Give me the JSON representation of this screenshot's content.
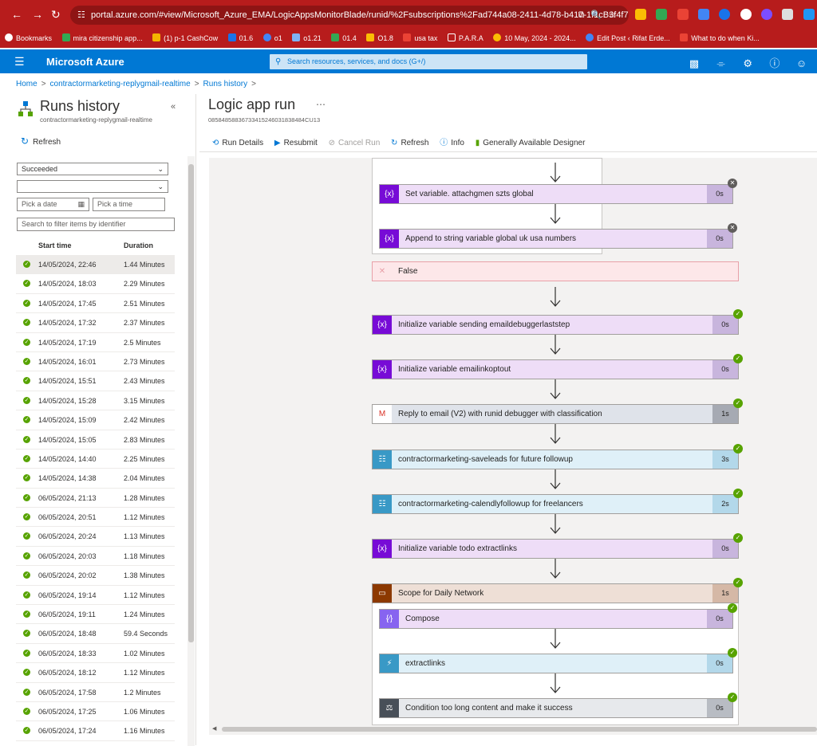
{
  "browser": {
    "url": "portal.azure.com/#view/Microsoft_Azure_EMA/LogicAppsMonitorBlade/runid/%2Fsubscriptions%2Fad744a08-2411-4d78-b417-1f1cB3f4f7...",
    "bookmarks": [
      "Bookmarks",
      "mira citizenship app...",
      "(1) p-1 CashCow",
      "01.6",
      "o1",
      "o1.21",
      "01.4",
      "O1.8",
      "usa tax",
      "P.A.R.A",
      "10 May, 2024 - 2024...",
      "Edit Post ‹ Rifat Erde...",
      "What to do when Ki..."
    ]
  },
  "azure": {
    "brand": "Microsoft Azure",
    "search_placeholder": "Search resources, services, and docs (G+/)"
  },
  "breadcrumb": [
    "Home",
    "contractormarketing-replygmail-realtime",
    "Runs history"
  ],
  "left": {
    "title": "Runs history",
    "subtitle": "contractormarketing-replygmail-realtime",
    "refresh": "Refresh",
    "status_filter": "Succeeded",
    "second_filter": "",
    "date_placeholder": "Pick a date",
    "time_placeholder": "Pick a time",
    "search_placeholder": "Search to filter items by identifier",
    "col_start": "Start time",
    "col_duration": "Duration",
    "runs": [
      {
        "start": "14/05/2024, 22:46",
        "duration": "1.44 Minutes"
      },
      {
        "start": "14/05/2024, 18:03",
        "duration": "2.29 Minutes"
      },
      {
        "start": "14/05/2024, 17:45",
        "duration": "2.51 Minutes"
      },
      {
        "start": "14/05/2024, 17:32",
        "duration": "2.37 Minutes"
      },
      {
        "start": "14/05/2024, 17:19",
        "duration": "2.5 Minutes"
      },
      {
        "start": "14/05/2024, 16:01",
        "duration": "2.73 Minutes"
      },
      {
        "start": "14/05/2024, 15:51",
        "duration": "2.43 Minutes"
      },
      {
        "start": "14/05/2024, 15:28",
        "duration": "3.15 Minutes"
      },
      {
        "start": "14/05/2024, 15:09",
        "duration": "2.42 Minutes"
      },
      {
        "start": "14/05/2024, 15:05",
        "duration": "2.83 Minutes"
      },
      {
        "start": "14/05/2024, 14:40",
        "duration": "2.25 Minutes"
      },
      {
        "start": "14/05/2024, 14:38",
        "duration": "2.04 Minutes"
      },
      {
        "start": "06/05/2024, 21:13",
        "duration": "1.28 Minutes"
      },
      {
        "start": "06/05/2024, 20:51",
        "duration": "1.12 Minutes"
      },
      {
        "start": "06/05/2024, 20:24",
        "duration": "1.13 Minutes"
      },
      {
        "start": "06/05/2024, 20:03",
        "duration": "1.18 Minutes"
      },
      {
        "start": "06/05/2024, 20:02",
        "duration": "1.38 Minutes"
      },
      {
        "start": "06/05/2024, 19:14",
        "duration": "1.12 Minutes"
      },
      {
        "start": "06/05/2024, 19:11",
        "duration": "1.24 Minutes"
      },
      {
        "start": "06/05/2024, 18:48",
        "duration": "59.4 Seconds"
      },
      {
        "start": "06/05/2024, 18:33",
        "duration": "1.02 Minutes"
      },
      {
        "start": "06/05/2024, 18:12",
        "duration": "1.12 Minutes"
      },
      {
        "start": "06/05/2024, 17:58",
        "duration": "1.2 Minutes"
      },
      {
        "start": "06/05/2024, 17:25",
        "duration": "1.06 Minutes"
      },
      {
        "start": "06/05/2024, 17:24",
        "duration": "1.16 Minutes"
      }
    ]
  },
  "main": {
    "title": "Logic app run",
    "run_id": "08584858836733415246031838484CU13",
    "toolbar": {
      "run_details": "Run Details",
      "resubmit": "Resubmit",
      "cancel": "Cancel Run",
      "refresh": "Refresh",
      "info": "Info",
      "designer": "Generally Available Designer"
    },
    "steps": {
      "set_var": {
        "label": "Set variable. attachgmen szts global",
        "duration": "0s",
        "icon": "variable-icon"
      },
      "append": {
        "label": "Append to string variable global uk usa numbers",
        "duration": "0s",
        "icon": "variable-icon"
      },
      "false_branch": {
        "label": "False",
        "icon": "close-icon"
      },
      "init_debugger": {
        "label": "Initialize variable sending emaildebuggerlaststep",
        "duration": "0s",
        "icon": "variable-icon"
      },
      "init_optout": {
        "label": "Initialize variable emailinkoptout",
        "duration": "0s",
        "icon": "variable-icon"
      },
      "reply_email": {
        "label": "Reply to email (V2) with runid debugger with classification",
        "duration": "1s",
        "icon": "gmail-icon"
      },
      "saveleads": {
        "label": "contractormarketing-saveleads for future followup",
        "duration": "3s",
        "icon": "workflow-icon"
      },
      "calendly": {
        "label": "contractormarketing-calendlyfollowup for freelancers",
        "duration": "2s",
        "icon": "workflow-icon"
      },
      "init_todo": {
        "label": "Initialize variable todo extractlinks",
        "duration": "0s",
        "icon": "variable-icon"
      },
      "scope": {
        "label": "Scope for Daily Network",
        "duration": "1s",
        "icon": "scope-icon"
      },
      "compose": {
        "label": "Compose",
        "duration": "0s",
        "icon": "compose-icon"
      },
      "extractlinks": {
        "label": "extractlinks",
        "duration": "0s",
        "icon": "function-icon"
      },
      "condition": {
        "label": "Condition too long content and make it success",
        "duration": "0s",
        "icon": "condition-icon"
      }
    }
  },
  "colors": {
    "azure_blue": "#0078d4",
    "browser_red": "#b71c1c",
    "success_green": "#57a300",
    "variable_purple": "#770bd6",
    "variable_bg": "#eeddf7",
    "workflow_bg": "#dff0f8",
    "gmail_bg": "#dfe3ea",
    "scope_bg": "#eedfd6",
    "false_bg": "#fde7e9",
    "condition_bg": "#e7e9ec"
  }
}
